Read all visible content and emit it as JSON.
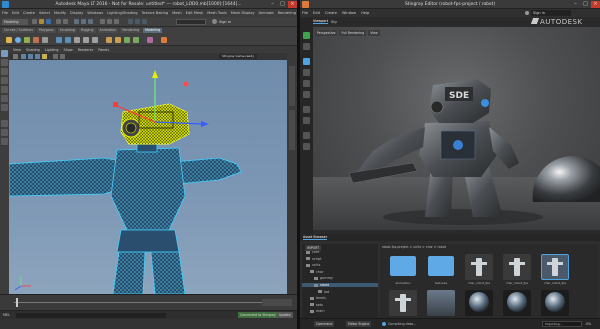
{
  "maya": {
    "title": "Autodesk Maya LT 2016 - Not for Resale: untitled* --- robot_LOD0.mb[1000]:[1644]...",
    "menu": [
      "File",
      "Edit",
      "Create",
      "Select",
      "Modify",
      "Display",
      "Windows",
      "Lighting/Shading",
      "Texture Baking",
      "Mesh",
      "Edit Mesh",
      "Mesh Tools",
      "Mesh Display",
      "Animate",
      "Rendering",
      "Muscle",
      "Help"
    ],
    "workspace": "Modeling",
    "sign_in": "Sign in",
    "shelf_tabs": [
      "Curves / Surfaces",
      "Polygons",
      "Sculpting",
      "Rigging",
      "Animation",
      "Rendering"
    ],
    "active_shelf": "Modeling",
    "panel_menu": [
      "View",
      "Shading",
      "Lighting",
      "Show",
      "Renderer",
      "Panels"
    ],
    "camera_field": "Stingray Game-ready",
    "command_label": "MEL",
    "connect_btn": "Connected to Stingray",
    "update_btn": "Update"
  },
  "stingray": {
    "title": "Stingray Editor (robot-fps-project / robot)",
    "menu": [
      "File",
      "Edit",
      "Create",
      "Window",
      "Help"
    ],
    "sign_in": "Sign in",
    "brand": "AUTODESK",
    "viewport_tabs": [
      "Level Viewport",
      "Sky"
    ],
    "viewport_modes": [
      "Perspective",
      "Full Rendering",
      "View"
    ],
    "asset_tabs": [
      "Asset Browser"
    ],
    "import_btn": "IMPORT",
    "breadcrumb": "robot-fps-project > units > char > robot",
    "tree": [
      "core",
      "script",
      "units",
      "char",
      "gummy",
      "robot",
      "lod",
      "levels",
      "sets",
      "main"
    ],
    "assets": [
      {
        "label": "animation",
        "kind": "folder"
      },
      {
        "label": "textures",
        "kind": "folder"
      },
      {
        "label": "char_robot_fps",
        "kind": "unit"
      },
      {
        "label": "char_robot_fps",
        "kind": "unit"
      },
      {
        "label": "char_robot_fps",
        "kind": "unit-selected"
      },
      {
        "label": "",
        "kind": "unit"
      },
      {
        "label": "",
        "kind": "scene"
      },
      {
        "label": "",
        "kind": "material"
      },
      {
        "label": "",
        "kind": "material"
      },
      {
        "label": "",
        "kind": "material"
      }
    ],
    "status_tabs": [
      "Command",
      "Editor Engine"
    ],
    "status_msg": "Compiling data...",
    "progress_label": "Importing...",
    "progress_value": "0%"
  },
  "colors": {
    "accent": "#4ea3e0",
    "wire": "#3fd0ff",
    "highlight": "#e8f000"
  }
}
